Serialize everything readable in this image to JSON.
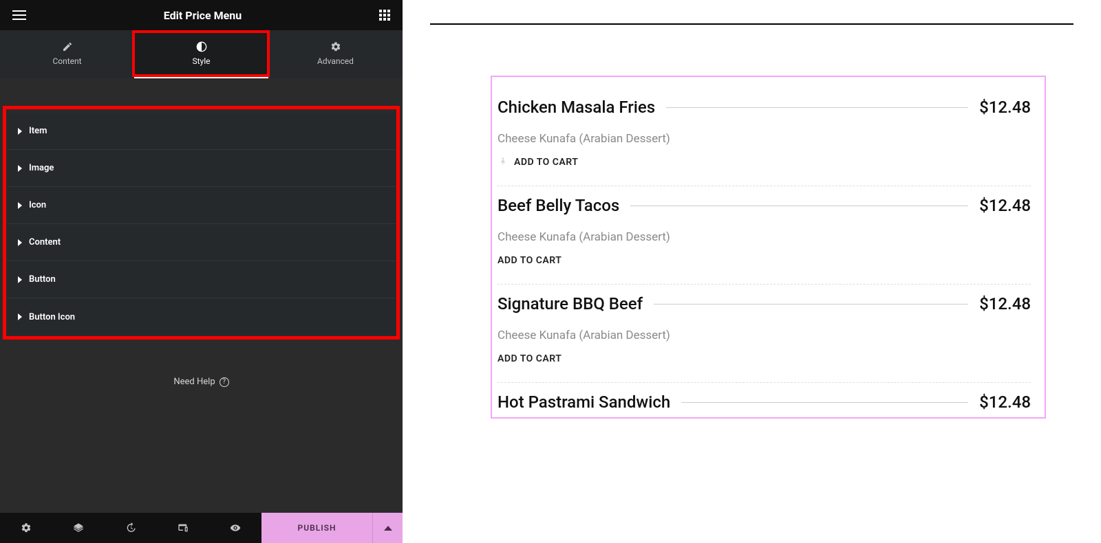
{
  "panel": {
    "title": "Edit Price Menu",
    "tabs": {
      "content": "Content",
      "style": "Style",
      "advanced": "Advanced",
      "active": "style"
    },
    "accordion": [
      "Item",
      "Image",
      "Icon",
      "Content",
      "Button",
      "Button Icon"
    ],
    "need_help": "Need Help",
    "publish": "PUBLISH"
  },
  "preview": {
    "items": [
      {
        "title": "Chicken Masala Fries",
        "price": "$12.48",
        "desc": "Cheese Kunafa (Arabian Dessert)",
        "cart": "ADD TO CART",
        "show_icon": true
      },
      {
        "title": "Beef Belly Tacos",
        "price": "$12.48",
        "desc": "Cheese Kunafa (Arabian Dessert)",
        "cart": "ADD TO CART",
        "show_icon": false
      },
      {
        "title": "Signature BBQ Beef",
        "price": "$12.48",
        "desc": "Cheese Kunafa (Arabian Dessert)",
        "cart": "ADD TO CART",
        "show_icon": false
      },
      {
        "title": "Hot Pastrami Sandwich",
        "price": "$12.48",
        "desc": "",
        "cart": "",
        "show_icon": false
      }
    ]
  }
}
